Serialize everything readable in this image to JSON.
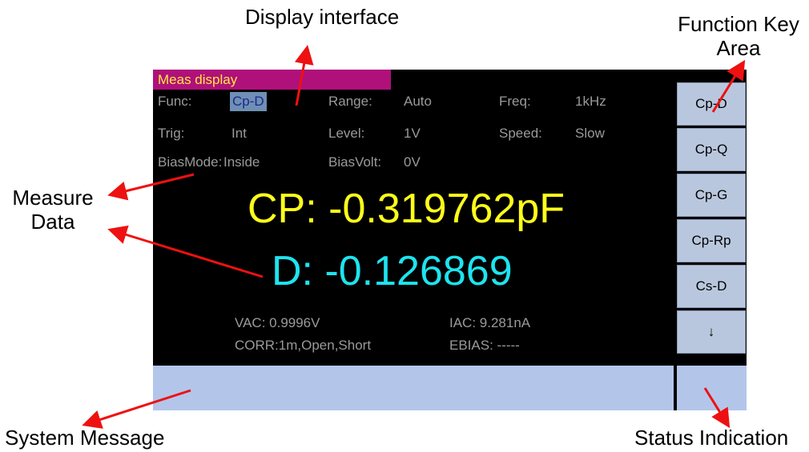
{
  "callouts": {
    "display_interface": "Display interface",
    "function_key_area_line1": "Function Key",
    "function_key_area_line2": "Area",
    "measure_data_line1": "Measure",
    "measure_data_line2": "Data",
    "system_message": "System Message",
    "status_indication": "Status Indication"
  },
  "screen": {
    "title": "Meas display",
    "params": {
      "func_label": "Func:",
      "func_value": "Cp-D",
      "range_label": "Range:",
      "range_value": "Auto",
      "freq_label": "Freq:",
      "freq_value": "1kHz",
      "trig_label": "Trig:",
      "trig_value": "Int",
      "level_label": "Level:",
      "level_value": "1V",
      "speed_label": "Speed:",
      "speed_value": "Slow",
      "biasmode_label": "BiasMode:",
      "biasmode_value": "Inside",
      "biasvolt_label": "BiasVolt:",
      "biasvolt_value": "0V"
    },
    "primary": "CP: -0.319762pF",
    "secondary": "D: -0.126869",
    "vac": "VAC:  0.9996V",
    "iac": "IAC:   9.281nA",
    "corr": "CORR:1m,Open,Short",
    "ebias": "EBIAS: -----",
    "function_keys": [
      "Cp-D",
      "Cp-Q",
      "Cp-G",
      "Cp-Rp",
      "Cs-D",
      "↓"
    ]
  },
  "colors": {
    "title_bg": "#b0107a",
    "title_text": "#ffe840",
    "primary": "#ffff1a",
    "secondary": "#1de4ef",
    "key_bg": "#b9c7de",
    "msg_bg": "#b3c6ea",
    "arrow": "#ee1111"
  }
}
